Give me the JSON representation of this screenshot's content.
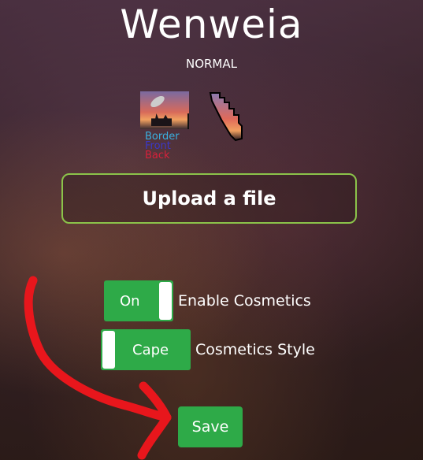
{
  "header": {
    "title": "Wenweia",
    "subtitle": "NORMAL"
  },
  "preview": {
    "legend": {
      "border": "Border",
      "front": "Front",
      "back": "Back"
    },
    "legend_colors": {
      "border": "#3ab0e0",
      "front": "#3a38c8",
      "back": "#d8203a"
    }
  },
  "upload": {
    "label": "Upload a file"
  },
  "cosmetics": {
    "enable_toggle": {
      "state": "On",
      "label": "Enable Cosmetics"
    },
    "style_toggle": {
      "state": "Cape",
      "label": "Cosmetics Style"
    }
  },
  "save": {
    "label": "Save"
  },
  "colors": {
    "accent_green": "#2eaa48",
    "upload_border": "#8bc34a",
    "annotation_red": "#e8161c"
  }
}
